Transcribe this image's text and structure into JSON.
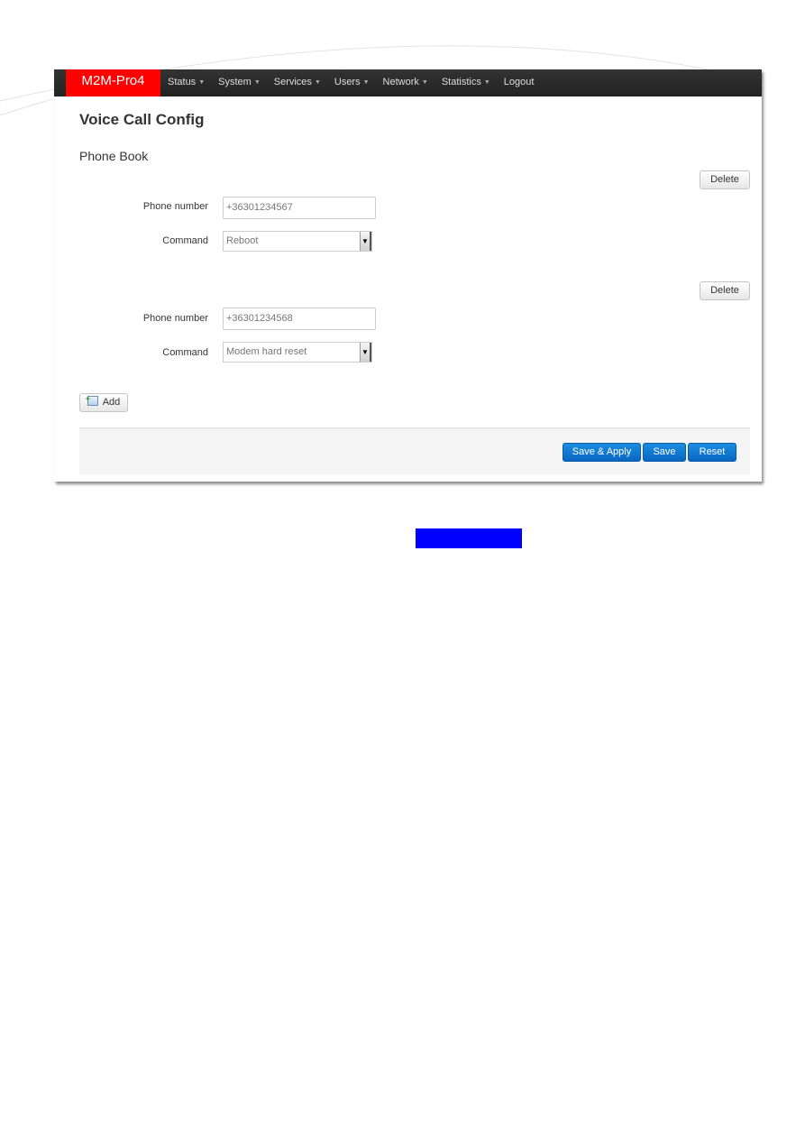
{
  "navbar": {
    "brand": "M2M-Pro4",
    "items": [
      {
        "label": "Status",
        "has_dropdown": true
      },
      {
        "label": "System",
        "has_dropdown": true
      },
      {
        "label": "Services",
        "has_dropdown": true
      },
      {
        "label": "Users",
        "has_dropdown": true
      },
      {
        "label": "Network",
        "has_dropdown": true
      },
      {
        "label": "Statistics",
        "has_dropdown": true
      },
      {
        "label": "Logout",
        "has_dropdown": false
      }
    ],
    "caret": "▼",
    "brand_color": "#ff0000"
  },
  "page": {
    "title": "Voice Call Config",
    "section_title": "Phone Book"
  },
  "phonebook": {
    "entries": [
      {
        "delete_label": "Delete",
        "phone_label": "Phone number",
        "phone_value": "+36301234567",
        "command_label": "Command",
        "command_value": "Reboot"
      },
      {
        "delete_label": "Delete",
        "phone_label": "Phone number",
        "phone_value": "+36301234568",
        "command_label": "Command",
        "command_value": "Modem hard reset"
      }
    ],
    "add_label": "Add"
  },
  "footer": {
    "save_apply_label": "Save & Apply",
    "save_label": "Save",
    "reset_label": "Reset",
    "primary_color": "#0a66c2"
  },
  "icons": {
    "select_arrow": "▼"
  }
}
